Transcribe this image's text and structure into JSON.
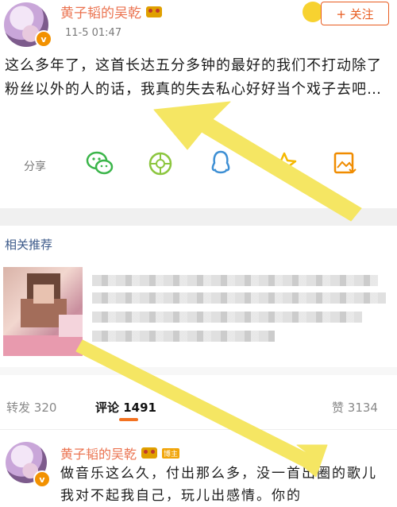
{
  "post": {
    "username": "黄子韬的吴乾",
    "time": "11-5 01:47",
    "follow_label": "+ 关注",
    "text": "这么多年了，这首长达五分多钟的最好的我们不打动除了粉丝以外的人的话，我真的失去私心好好当个戏子去吧…"
  },
  "actions": {
    "share_label": "分享",
    "icons": [
      "wechat-icon",
      "moments-icon",
      "qq-icon",
      "qzone-icon",
      "save-image-icon"
    ]
  },
  "related": {
    "title": "相关推荐"
  },
  "tabs": {
    "repost_label": "转发",
    "repost_count": "320",
    "comment_label": "评论",
    "comment_count": "1491",
    "like_label": "赞",
    "like_count": "3134"
  },
  "comment": {
    "username": "黄子韬的吴乾",
    "tag": "博主",
    "text": "做音乐这么久，付出那么多，没一首出圈的歌儿我对不起我自己，玩儿出感情。你的"
  },
  "colors": {
    "accent": "#eb7350",
    "arrow": "#f5e663",
    "link": "#3c5a8a"
  }
}
